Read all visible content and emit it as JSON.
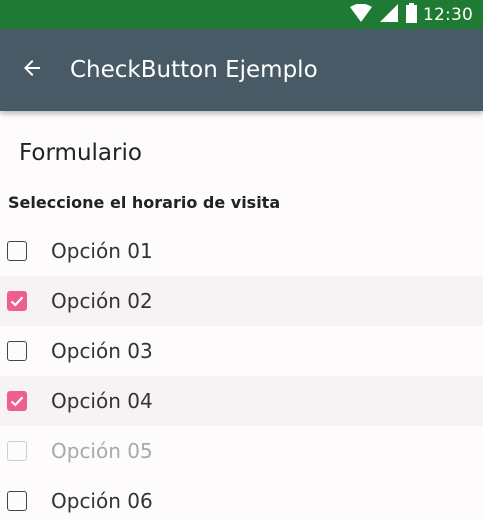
{
  "status_bar": {
    "time": "12:30",
    "icons": [
      "wifi-icon",
      "signal-icon",
      "battery-icon"
    ]
  },
  "app_bar": {
    "title": "CheckButton Ejemplo",
    "back_icon": "arrow-left-icon"
  },
  "form": {
    "title": "Formulario",
    "subtitle": "Seleccione el horario de visita",
    "options": [
      {
        "label": "Opción 01",
        "checked": false,
        "disabled": false
      },
      {
        "label": "Opción 02",
        "checked": true,
        "disabled": false
      },
      {
        "label": "Opción 03",
        "checked": false,
        "disabled": false
      },
      {
        "label": "Opción 04",
        "checked": true,
        "disabled": false
      },
      {
        "label": "Opción 05",
        "checked": false,
        "disabled": true
      },
      {
        "label": "Opción 06",
        "checked": false,
        "disabled": false
      }
    ]
  },
  "colors": {
    "status_bar": "#1f7a33",
    "app_bar": "#475a66",
    "accent": "#ec5f8e",
    "checked_row": "#f7f2f4"
  }
}
